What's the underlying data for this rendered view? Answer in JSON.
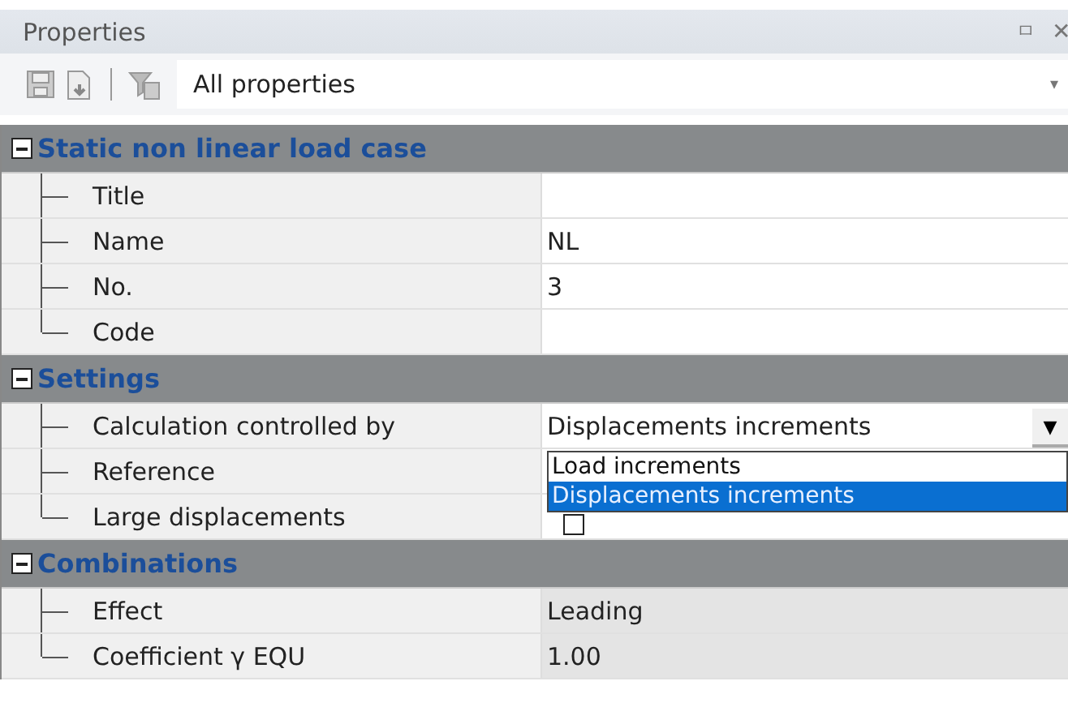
{
  "panel": {
    "title": "Properties",
    "pin": "ㅁ",
    "close": "✕"
  },
  "toolbar": {
    "filter": "All properties",
    "caret": "▾"
  },
  "sections": [
    {
      "title": "Static non linear load case",
      "expanded": true,
      "rows": [
        {
          "label": "Title",
          "readonly": false
        },
        {
          "label": "Name",
          "value": "NL",
          "readonly": false
        },
        {
          "label": "No.",
          "value": "3",
          "readonly": false
        },
        {
          "label": "Code",
          "readonly": false
        }
      ]
    },
    {
      "title": "Settings",
      "expanded": true,
      "rows": [
        {
          "label": "Calculation controlled by",
          "value": "Displacements increments",
          "kind": "dropdown",
          "readonly": false,
          "dropdown": {
            "button": "▼",
            "options": [
              {
                "label": "Load increments",
                "selected": false
              },
              {
                "label": "Displacements increments",
                "selected": true
              }
            ]
          }
        },
        {
          "label": "Reference",
          "readonly": false
        },
        {
          "label": "Large displacements",
          "kind": "checkbox",
          "checked": false,
          "readonly": false
        }
      ]
    },
    {
      "title": "Combinations",
      "expanded": true,
      "rows": [
        {
          "label": "Effect",
          "value": "Leading",
          "readonly": true
        },
        {
          "label": "Coefficient γ EQU",
          "value": "1.00",
          "readonly": true
        }
      ]
    }
  ]
}
